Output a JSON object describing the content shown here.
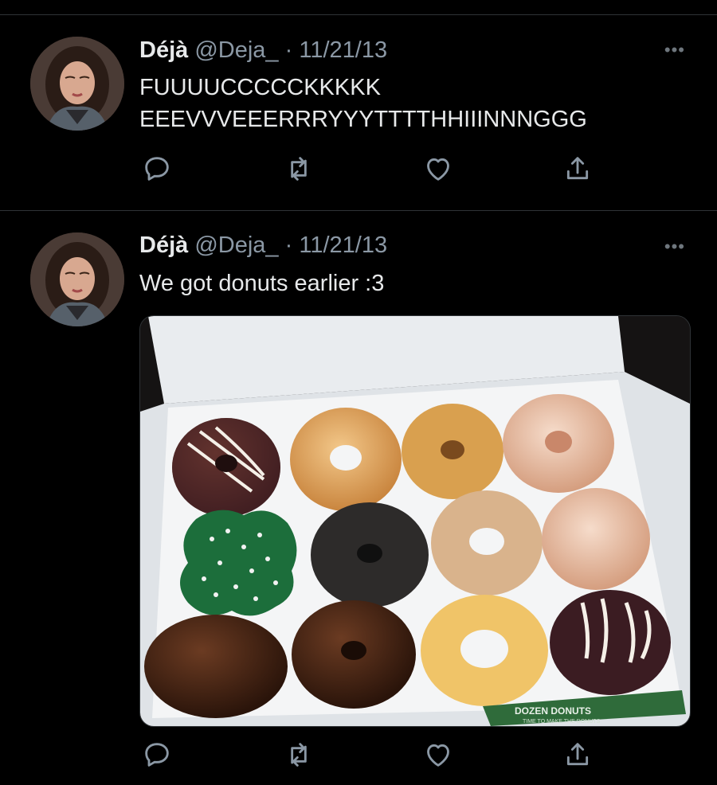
{
  "tweets": [
    {
      "display_name": "Déjà",
      "handle": "@Deja_",
      "date": "11/21/13",
      "text": "FUUUUCCCCCKKKKK\nEEEVVVEEERRRYYYTTTTHHIIINNNGGG",
      "avatar_icon": "profile-photo",
      "has_media": false
    },
    {
      "display_name": "Déjà",
      "handle": "@Deja_",
      "date": "11/21/13",
      "text": "We got donuts earlier :3",
      "avatar_icon": "profile-photo",
      "has_media": true,
      "media": {
        "description_icon": "donut-box-photo",
        "box_print": "DOZEN DONUTS",
        "box_tagline": "TIME TO MAKE THE DONUTS"
      }
    }
  ],
  "separator": "·",
  "more_label": "•••",
  "action_icons": [
    "reply-icon",
    "retweet-icon",
    "like-icon",
    "share-icon"
  ],
  "colors": {
    "background": "#000000",
    "text": "#e7e9ea",
    "secondary": "#8b98a5",
    "divider": "#2f3336"
  }
}
